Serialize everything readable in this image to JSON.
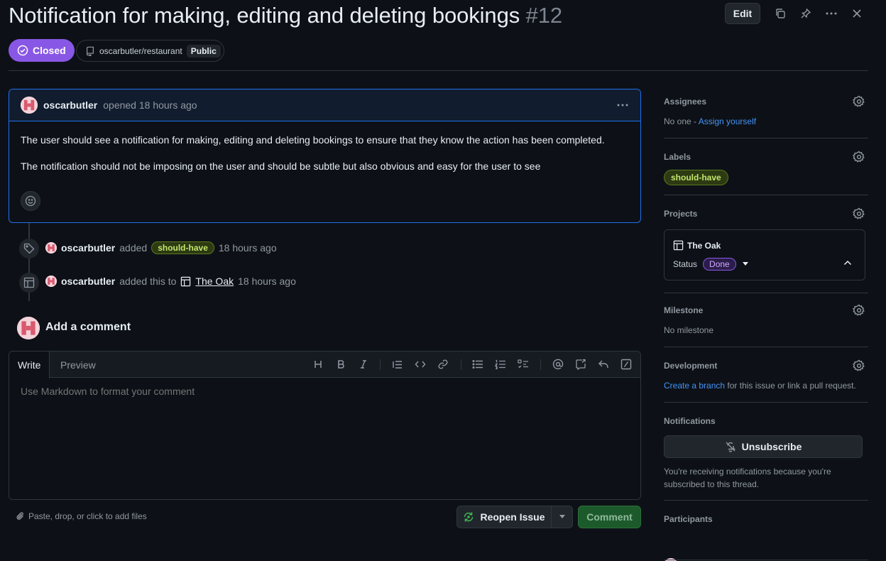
{
  "issue": {
    "title": "Notification for making, editing and deleting bookings",
    "number": "#12",
    "state": "Closed",
    "repo": "oscarbutler/restaurant",
    "visibility": "Public",
    "edit_label": "Edit"
  },
  "comment": {
    "author": "oscarbutler",
    "meta": "opened 18 hours ago",
    "paragraphs": [
      "The user should see a notification for making, editing and deleting bookings to ensure that they know the action has been completed.",
      "The notification should not be imposing on the user and should be subtle but also obvious and easy for the user to see"
    ]
  },
  "timeline": [
    {
      "icon": "tag-icon",
      "author": "oscarbutler",
      "action": "added",
      "label": "should-have",
      "time": "18 hours ago"
    },
    {
      "icon": "table-icon",
      "author": "oscarbutler",
      "action": "added this to",
      "project": "The Oak",
      "time": "18 hours ago"
    }
  ],
  "add_comment": {
    "title": "Add a comment",
    "tab_write": "Write",
    "tab_preview": "Preview",
    "placeholder": "Use Markdown to format your comment",
    "attach_text": "Paste, drop, or click to add files",
    "reopen_label": "Reopen Issue",
    "comment_label": "Comment"
  },
  "sidebar": {
    "assignees": {
      "title": "Assignees",
      "text": "No one - ",
      "link": "Assign yourself"
    },
    "labels": {
      "title": "Labels",
      "items": [
        "should-have"
      ]
    },
    "projects": {
      "title": "Projects",
      "name": "The Oak",
      "status_label": "Status",
      "status_value": "Done"
    },
    "milestone": {
      "title": "Milestone",
      "text": "No milestone"
    },
    "development": {
      "title": "Development",
      "link": "Create a branch",
      "text": " for this issue or link a pull request."
    },
    "notifications": {
      "title": "Notifications",
      "button": "Unsubscribe",
      "text": "You're receiving notifications because you're subscribed to this thread."
    },
    "participants": {
      "title": "Participants"
    }
  },
  "colors": {
    "closed_purple": "#8957e5",
    "label_green": "#c2e66d",
    "link_blue": "#4493f8",
    "background": "#0d1117"
  }
}
